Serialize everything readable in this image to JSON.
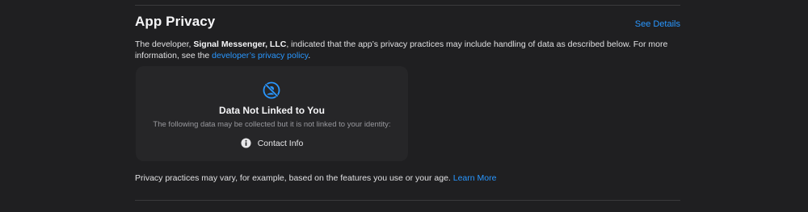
{
  "section": {
    "title": "App Privacy",
    "see_details": "See Details"
  },
  "description": {
    "prefix": "The developer, ",
    "developer_name": "Signal Messenger, LLC",
    "middle": ", indicated that the app’s privacy practices may include handling of data as described below. For more information, see the ",
    "policy_link": "developer’s privacy policy",
    "suffix": "."
  },
  "card": {
    "icon": "data-not-linked-icon",
    "title": "Data Not Linked to You",
    "subtitle": "The following data may be collected but it is not linked to your identity:",
    "items": [
      {
        "icon": "info-icon",
        "label": "Contact Info"
      }
    ]
  },
  "footer": {
    "note": "Privacy practices may vary, for example, based on the features you use or your age. ",
    "learn_more": "Learn More"
  },
  "colors": {
    "background": "#1f1f21",
    "card": "#262628",
    "link": "#2997ff",
    "divider": "#3a3a3c"
  }
}
